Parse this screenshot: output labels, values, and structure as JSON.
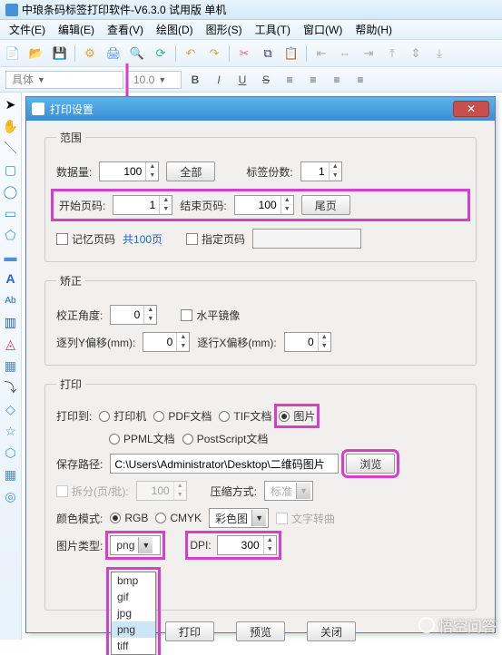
{
  "app": {
    "title": "中琅条码标签打印软件-V6.3.0 试用版 单机"
  },
  "menu": {
    "file": "文件(E)",
    "edit": "编辑(E)",
    "view": "查看(V)",
    "draw": "绘图(D)",
    "shape": "图形(S)",
    "tool": "工具(T)",
    "window": "窗口(W)",
    "help": "帮助(H)"
  },
  "fmt": {
    "font": "具体",
    "size": "10.0",
    "b": "B",
    "i": "I",
    "u": "U",
    "s": "S"
  },
  "dialog": {
    "title": "打印设置",
    "range": {
      "legend": "范围",
      "data_amount_label": "数据量:",
      "data_amount": "100",
      "all_btn": "全部",
      "copies_label": "标签份数:",
      "copies": "1",
      "start_label": "开始页码:",
      "start": "1",
      "end_label": "结束页码:",
      "end": "100",
      "last_btn": "尾页",
      "remember_label": "记忆页码",
      "total_text": "共100页",
      "specify_label": "指定页码"
    },
    "correct": {
      "legend": "矫正",
      "angle_label": "校正角度:",
      "angle": "0",
      "mirror_label": "水平镜像",
      "yoff_label": "逐列Y偏移(mm):",
      "yoff": "0",
      "xoff_label": "逐行X偏移(mm):",
      "xoff": "0"
    },
    "print": {
      "legend": "打印",
      "to_label": "打印到:",
      "opt_printer": "打印机",
      "opt_pdf": "PDF文档",
      "opt_tif": "TIF文档",
      "opt_img": "图片",
      "opt_ppml": "PPML文档",
      "opt_ps": "PostScript文档",
      "path_label": "保存路径:",
      "path": "C:\\Users\\Administrator\\Desktop\\二维码图片",
      "browse_btn": "浏览",
      "split_label": "拆分(页/批):",
      "split": "100",
      "compress_label": "压缩方式:",
      "compress": "标准",
      "color_label": "颜色模式:",
      "opt_rgb": "RGB",
      "opt_cmyk": "CMYK",
      "colorimg": "彩色图",
      "textcurve_label": "文字转曲",
      "type_label": "图片类型:",
      "type": "png",
      "dpi_label": "DPI:",
      "dpi": "300"
    },
    "dropdown": {
      "items": [
        "bmp",
        "gif",
        "jpg",
        "png",
        "tiff"
      ],
      "selected": "png"
    },
    "buttons": {
      "print": "打印",
      "preview": "预览",
      "close": "关闭"
    }
  },
  "watermark": "悟空问答"
}
